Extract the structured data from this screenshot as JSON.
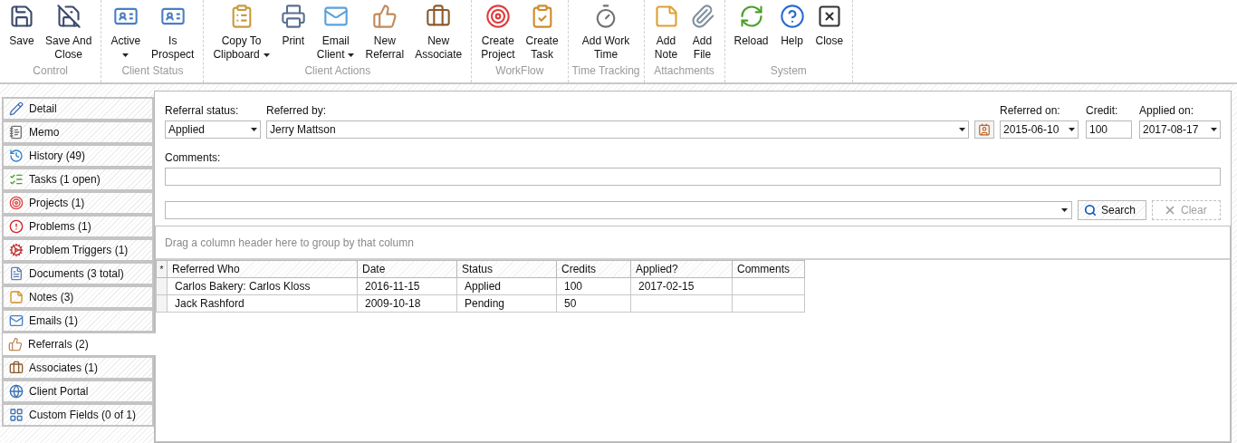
{
  "toolbar": {
    "groups": [
      {
        "label": "Control",
        "buttons": [
          {
            "kind": "plain",
            "label": [
              "Save"
            ]
          },
          {
            "kind": "plain",
            "label": [
              "Save And",
              "Close"
            ]
          }
        ]
      },
      {
        "label": "Client Status",
        "buttons": [
          {
            "kind": "menu_below",
            "label": [
              "Active"
            ]
          },
          {
            "kind": "plain",
            "label": [
              "Is",
              "Prospect"
            ]
          }
        ]
      },
      {
        "label": "Client Actions",
        "buttons": [
          {
            "kind": "menu_inline",
            "label": [
              "Copy To",
              "Clipboard"
            ]
          },
          {
            "kind": "plain",
            "label": [
              "Print"
            ]
          },
          {
            "kind": "menu_inline",
            "label": [
              "Email",
              "Client"
            ]
          },
          {
            "kind": "plain",
            "label": [
              "New",
              "Referral"
            ]
          },
          {
            "kind": "plain",
            "label": [
              "New",
              "Associate"
            ]
          }
        ]
      },
      {
        "label": "WorkFlow",
        "buttons": [
          {
            "kind": "plain",
            "label": [
              "Create",
              "Project"
            ]
          },
          {
            "kind": "plain",
            "label": [
              "Create",
              "Task"
            ]
          }
        ]
      },
      {
        "label": "Time Tracking",
        "buttons": [
          {
            "kind": "plain",
            "label": [
              "Add Work",
              "Time"
            ]
          }
        ]
      },
      {
        "label": "Attachments",
        "buttons": [
          {
            "kind": "plain",
            "label": [
              "Add",
              "Note"
            ]
          },
          {
            "kind": "plain",
            "label": [
              "Add",
              "File"
            ]
          }
        ]
      },
      {
        "label": "System",
        "buttons": [
          {
            "kind": "plain",
            "label": [
              "Reload"
            ]
          },
          {
            "kind": "plain",
            "label": [
              "Help"
            ]
          },
          {
            "kind": "plain",
            "label": [
              "Close"
            ]
          }
        ]
      }
    ]
  },
  "sidebar": {
    "items": [
      {
        "label": "Detail",
        "selected": false
      },
      {
        "label": "Memo",
        "selected": false
      },
      {
        "label": "History (49)",
        "selected": false
      },
      {
        "label": "Tasks (1 open)",
        "selected": false
      },
      {
        "label": "Projects (1)",
        "selected": false
      },
      {
        "label": "Problems (1)",
        "selected": false
      },
      {
        "label": "Problem Triggers (1)",
        "selected": false
      },
      {
        "label": "Documents (3 total)",
        "selected": false
      },
      {
        "label": "Notes (3)",
        "selected": false
      },
      {
        "label": "Emails (1)",
        "selected": false
      },
      {
        "label": "Referrals (2)",
        "selected": true
      },
      {
        "label": "Associates (1)",
        "selected": false
      },
      {
        "label": "Client Portal",
        "selected": false
      },
      {
        "label": "Custom Fields (0 of 1)",
        "selected": false
      }
    ]
  },
  "form": {
    "referral_status": {
      "label": "Referral status:",
      "value": "Applied"
    },
    "referred_by": {
      "label": "Referred by:",
      "value": "Jerry Mattson"
    },
    "referred_on": {
      "label": "Referred on:",
      "value": "2015-06-10"
    },
    "credit": {
      "label": "Credit:",
      "value": "100"
    },
    "applied_on": {
      "label": "Applied on:",
      "value": "2017-08-17"
    },
    "comments": {
      "label": "Comments:"
    }
  },
  "search_bar": {
    "search_button": "Search",
    "clear_button": {
      "label": "Clear",
      "disabled": true
    }
  },
  "grid": {
    "group_hint": "Drag a column header here to group by that column",
    "new_row_marker": "*",
    "columns": [
      "Referred Who",
      "Date",
      "Status",
      "Credits",
      "Applied?",
      "Comments"
    ],
    "rows": [
      [
        "Carlos Bakery: Carlos Kloss",
        "2016-11-15",
        "Applied",
        "100",
        "2017-02-15",
        ""
      ],
      [
        "Jack Rashford",
        "2009-10-18",
        "Pending",
        "50",
        "",
        ""
      ]
    ]
  }
}
